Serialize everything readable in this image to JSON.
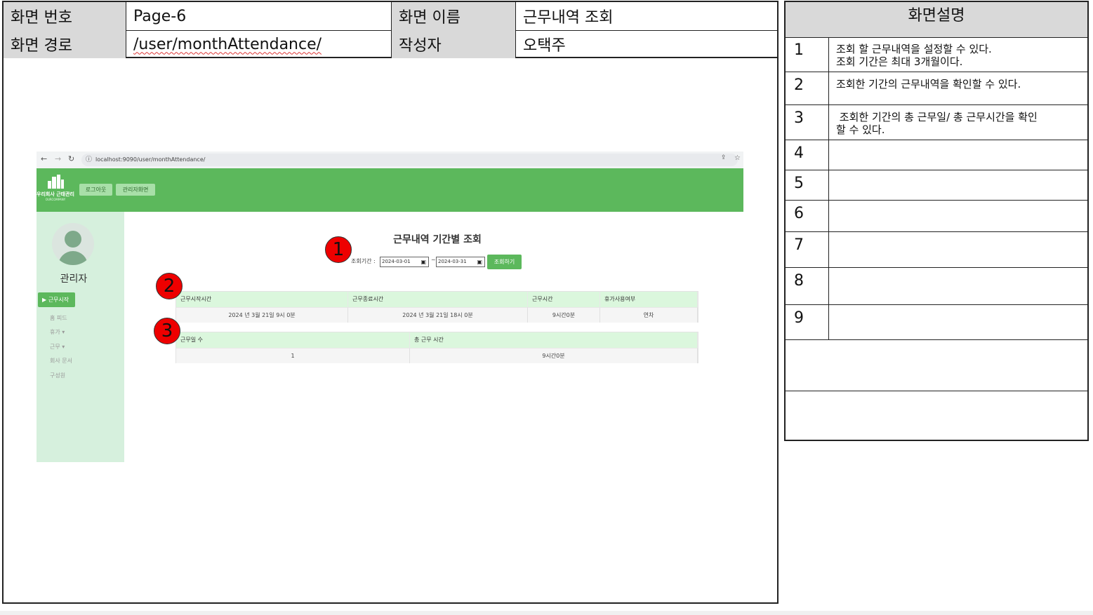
{
  "meta": {
    "screen_no_label": "화면 번호",
    "screen_no": "Page-6",
    "screen_name_label": "화면 이름",
    "screen_name": "근무내역 조회",
    "screen_path_label": "화면 경로",
    "screen_path": "/user/monthAttendance/",
    "author_label": "작성자",
    "author": "오택주"
  },
  "description": {
    "title": "화면설명",
    "rows": [
      {
        "num": "1",
        "text": "조회 할 근무내역을 설정할 수 있다.\n조회 기간은 최대 3개월이다."
      },
      {
        "num": "2",
        "text": "조회한 기간의 근무내역을 확인할 수 있다."
      },
      {
        "num": "3",
        "text": " 조회한 기간의 총 근무일/ 총 근무시간을 확인\n할 수 있다."
      },
      {
        "num": "4",
        "text": ""
      },
      {
        "num": "5",
        "text": ""
      },
      {
        "num": "6",
        "text": ""
      },
      {
        "num": "7",
        "text": ""
      },
      {
        "num": "8",
        "text": ""
      },
      {
        "num": "9",
        "text": ""
      }
    ]
  },
  "browser": {
    "url": "localhost:9090/user/monthAttendance/"
  },
  "app": {
    "logo_text": "우리회사 근태관리",
    "logo_sub": "OURCOMPANY",
    "logout_label": "로그아웃",
    "admin_screen_label": "관리자화면",
    "admin_name": "관리자",
    "start_work_label": "▶ 근무시작",
    "nav": [
      "홈 피드",
      "휴가 ▾",
      "근무 ▾",
      "회사 문서",
      "구성원"
    ],
    "page_heading": "근무내역 기간별 조회",
    "period_label": "조회기간 :",
    "date_from": "2024-03-01",
    "date_to": "2024-03-31",
    "tilde": "~",
    "search_label": "조회하기",
    "records": {
      "headers": [
        "근무시작시간",
        "근무종료시간",
        "근무시간",
        "휴가사용여부"
      ],
      "rows": [
        [
          "2024 년 3월 21일 9시 0분",
          "2024 년 3월 21일 18시 0분",
          "9시간0분",
          "연차"
        ]
      ]
    },
    "summary": {
      "headers": [
        "근무일 수",
        "총 근무 시간"
      ],
      "rows": [
        [
          "1",
          "9시간0분"
        ]
      ]
    }
  },
  "markers": [
    "1",
    "2",
    "3"
  ],
  "colors": {
    "brand_green": "#5cb85c",
    "sidebar_bg": "#d6f0dd",
    "table_header_bg": "#dbf7dd",
    "marker_red": "#ee0000",
    "label_gray": "#d9d9d9"
  }
}
